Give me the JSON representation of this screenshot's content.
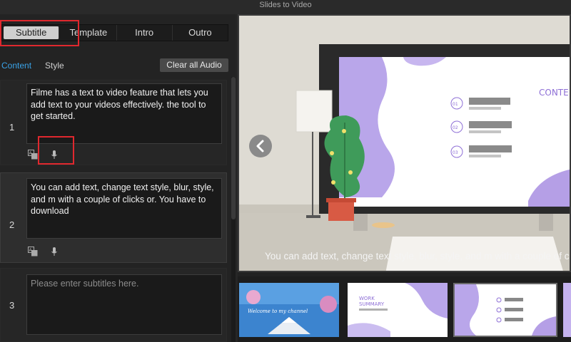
{
  "window": {
    "title": "Slides to Video"
  },
  "tabs": [
    {
      "label": "Subtitle",
      "active": true
    },
    {
      "label": "Template",
      "active": false
    },
    {
      "label": "Intro",
      "active": false
    },
    {
      "label": "Outro",
      "active": false
    }
  ],
  "subtabs": {
    "content": "Content",
    "style": "Style"
  },
  "toolbar": {
    "clear_audio_label": "Clear all Audio"
  },
  "subtitles": [
    {
      "number": "1",
      "text": "Filme has a text to video feature that lets you add text to your videos effectively.  the tool to get started."
    },
    {
      "number": "2",
      "text": "You can add text, change text style, blur, style, and m with a couple of clicks or. You have to download"
    },
    {
      "number": "3",
      "text": "",
      "placeholder": "Please enter subtitles here."
    }
  ],
  "preview": {
    "subtitle_text": "You can add text, change text style, blur, style, and m with a couple of clicks or. You have to download",
    "slide_heading": "CONTE",
    "list_numbers": [
      "01",
      "02",
      "03"
    ]
  },
  "filmstrip": {
    "thumb2_title": "WORK\nSUMMARY",
    "thumb2_title_line1": "WORK",
    "thumb2_title_line2": "SUMMARY",
    "thumb1_caption": "Welcome to my channel"
  },
  "colors": {
    "accent": "#3aa3e8",
    "highlight": "#e0282e",
    "plant": "#3f9b5a",
    "slide_purple": "#b8a6e6"
  },
  "icons": [
    "subtitle-translate-icon",
    "microphone-icon",
    "chevron-left-icon"
  ]
}
